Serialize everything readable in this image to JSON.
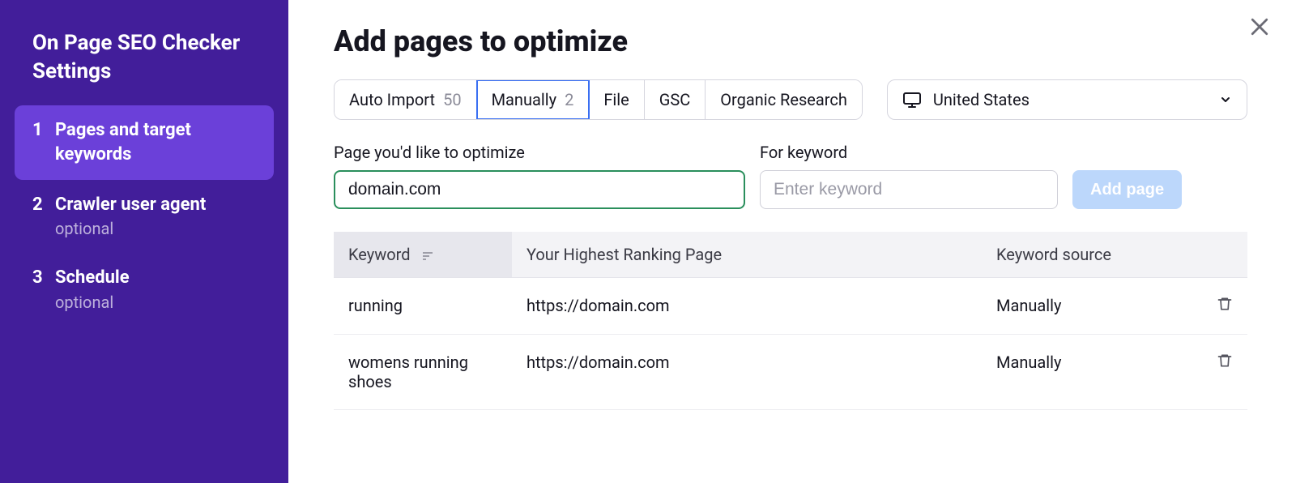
{
  "sidebar": {
    "title": "On Page SEO Checker Settings",
    "steps": [
      {
        "num": "1",
        "label": "Pages and target keywords",
        "sub": null,
        "active": true
      },
      {
        "num": "2",
        "label": "Crawler user agent",
        "sub": "optional",
        "active": false
      },
      {
        "num": "3",
        "label": "Schedule",
        "sub": "optional",
        "active": false
      }
    ]
  },
  "main": {
    "title": "Add pages to optimize",
    "tabs": [
      {
        "label": "Auto Import",
        "count": "50",
        "active": false
      },
      {
        "label": "Manually",
        "count": "2",
        "active": true
      },
      {
        "label": "File",
        "count": null,
        "active": false
      },
      {
        "label": "GSC",
        "count": null,
        "active": false
      },
      {
        "label": "Organic Research",
        "count": null,
        "active": false
      }
    ],
    "country": {
      "label": "United States"
    },
    "fields": {
      "page": {
        "label": "Page you'd like to optimize",
        "value": "domain.com"
      },
      "keyword": {
        "label": "For keyword",
        "placeholder": "Enter keyword"
      }
    },
    "addPageBtn": "Add page",
    "table": {
      "headers": {
        "keyword": "Keyword",
        "page": "Your Highest Ranking Page",
        "source": "Keyword source"
      },
      "rows": [
        {
          "keyword": "running",
          "page": "https://domain.com",
          "source": "Manually"
        },
        {
          "keyword": "womens running shoes",
          "page": "https://domain.com",
          "source": "Manually"
        }
      ]
    }
  }
}
